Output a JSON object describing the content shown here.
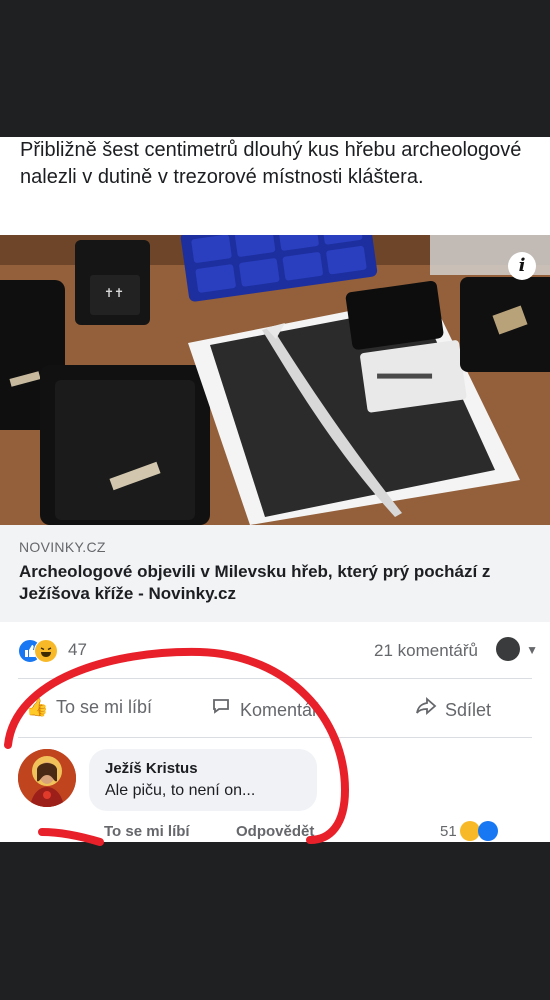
{
  "post": {
    "caption": "Přibližně šest centimetrů dlouhý kus hřebu archeologové nalezli v dutině v trezorové místnosti kláštera.",
    "info_label": "i"
  },
  "link_preview": {
    "domain": "NOVINKY.CZ",
    "title": "Archeologové objevili v Milevsku hřeb, který prý pochází z Ježíšova kříže - Novinky.cz"
  },
  "stats": {
    "reaction_count": "47",
    "comment_count": "21 komentářů"
  },
  "actions": {
    "like": "To se mi líbí",
    "comment": "Komentář",
    "share": "Sdílet"
  },
  "comment": {
    "author": "Ježíš Kristus",
    "text": "Ale piču, to není on...",
    "like_label": "To se mi líbí",
    "reply_label": "Odpovědět",
    "reaction_count": "51"
  },
  "colors": {
    "facebook_blue": "#1877f2",
    "haha_yellow": "#f7b928",
    "annotation_red": "#e8202a"
  },
  "icons": [
    "info-icon",
    "like-reaction-icon",
    "haha-reaction-icon",
    "globe-icon",
    "thumbs-up-icon",
    "comment-icon",
    "share-icon"
  ]
}
